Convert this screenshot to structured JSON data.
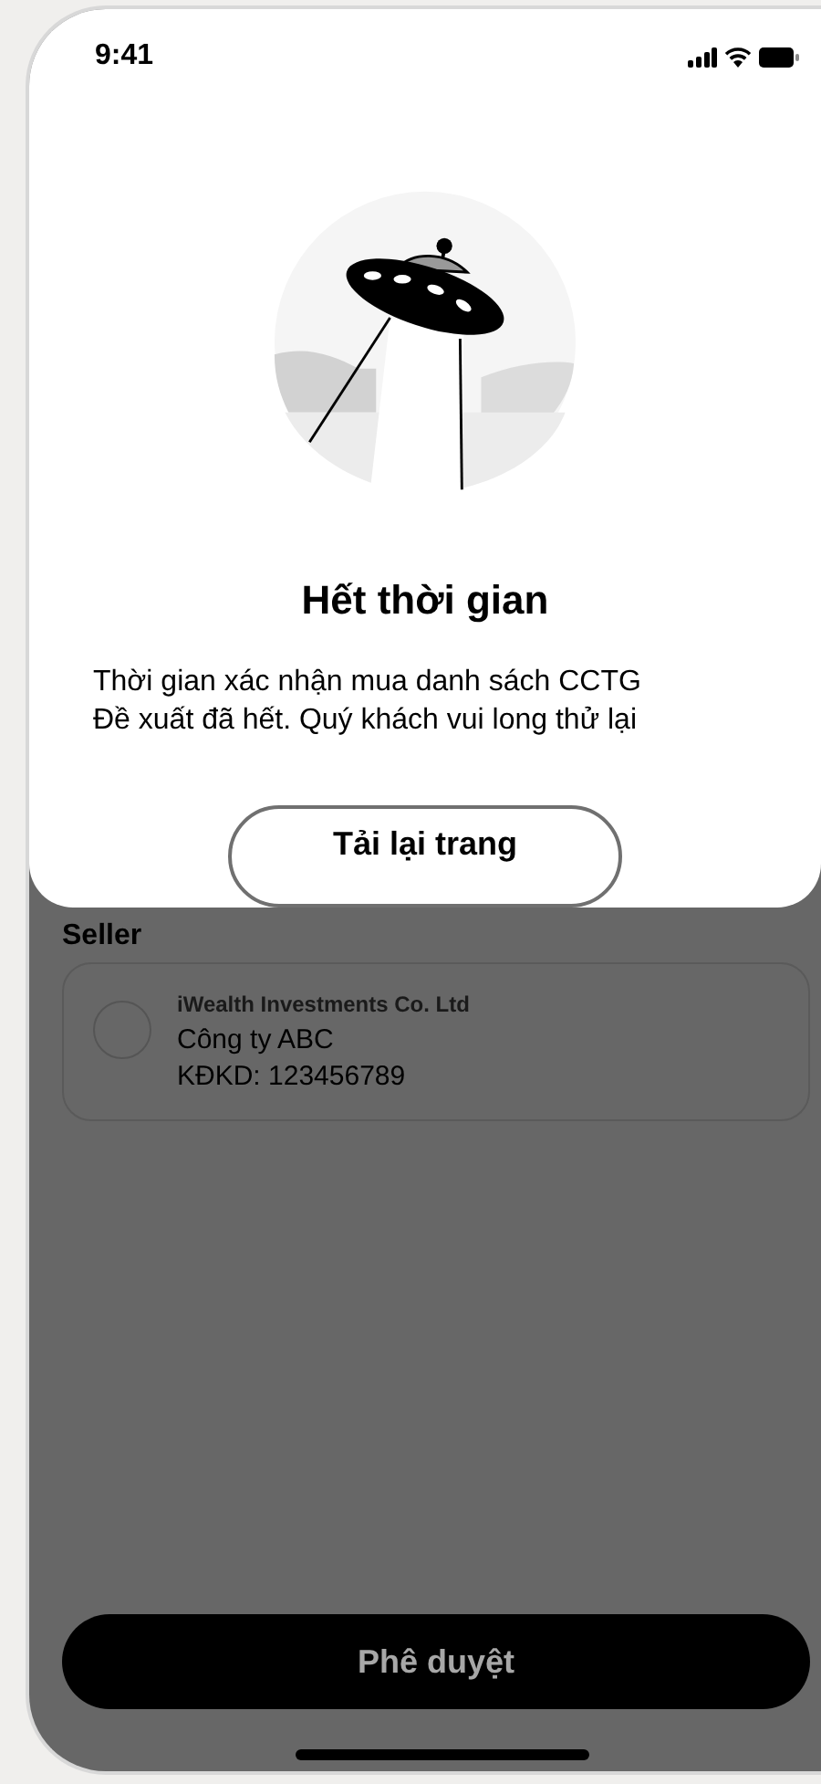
{
  "status_bar": {
    "time": "9:41"
  },
  "dialog": {
    "title": "Hết thời gian",
    "message_lines": [
      "Thời gian xác nhận mua danh sách CCTG",
      "Đề xuất đã hết. Quý khách vui long thử lại"
    ],
    "button": "Tải lại trang"
  },
  "seller": {
    "heading": "Seller",
    "name": "iWealth Investments Co. Ltd",
    "company": "Công ty ABC",
    "license": "KĐKD: 123456789"
  },
  "approve_button": "Phê duyệt"
}
